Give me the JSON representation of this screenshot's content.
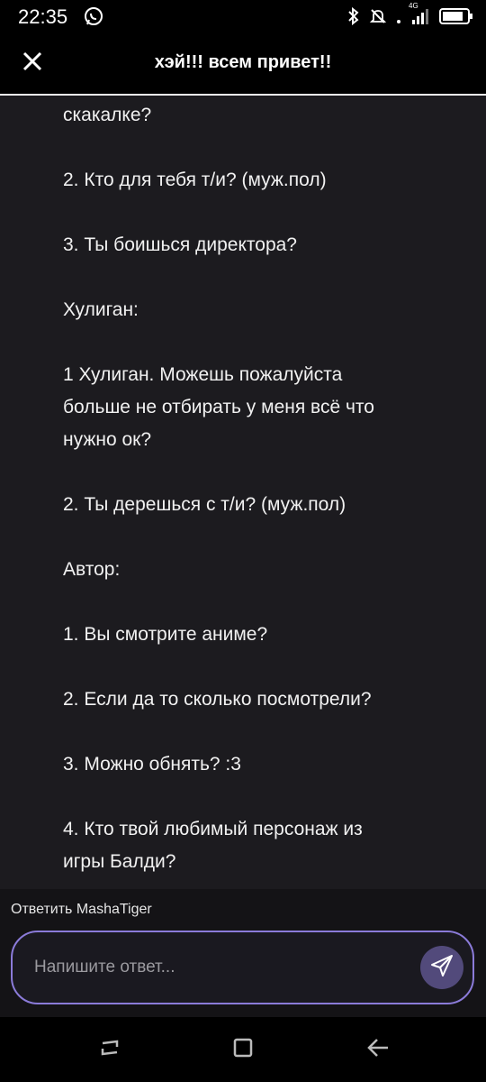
{
  "status_bar": {
    "time": "22:35",
    "network_label": "4G",
    "icons": [
      "whatsapp-icon",
      "bluetooth-icon",
      "mute-icon",
      "signal-icon",
      "battery-icon"
    ]
  },
  "header": {
    "title": "хэй!!! всем привет!!",
    "close_icon": "close-icon"
  },
  "content": {
    "paragraphs": [
      [
        "скакалке?"
      ],
      [
        "2. Кто для тебя т/и? (муж.пол)"
      ],
      [
        "3. Ты боишься директора?"
      ],
      [
        "Хулиган:"
      ],
      [
        "1 Хулиган. Можешь пожалуйста",
        "больше не отбирать у меня всё что",
        "нужно ок?"
      ],
      [
        "2. Ты дерешься с т/и? (муж.пол)"
      ],
      [
        "Автор:"
      ],
      [
        "1. Вы смотрите аниме?"
      ],
      [
        "2. Если да то сколько посмотрели?"
      ],
      [
        "3. Можно обнять? :3"
      ],
      [
        "4. Кто твой любимый персонаж из",
        "игры Балди?"
      ]
    ]
  },
  "reply": {
    "reply_to_label": "Ответить MashaTiger",
    "input_placeholder": "Напишите ответ...",
    "send_icon": "send-icon"
  },
  "nav_bar": {
    "icons": [
      "recents-icon",
      "home-icon",
      "back-icon"
    ]
  },
  "colors": {
    "content_bg": "#1c1b1f",
    "input_border": "#8b7bd9",
    "send_button": "#524a7b"
  }
}
